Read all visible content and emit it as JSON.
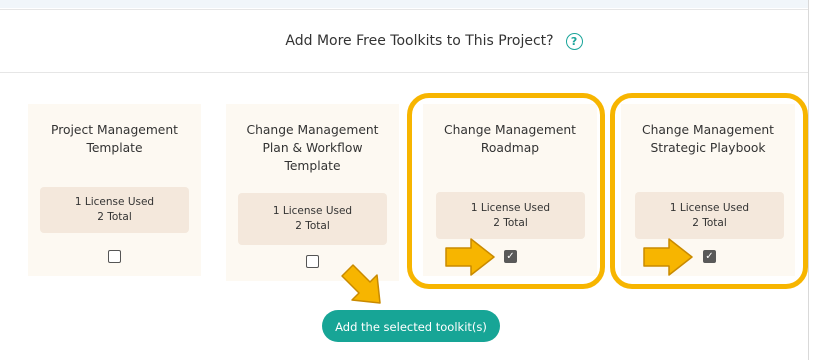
{
  "header": {
    "title": "Add More Free Toolkits to This Project?",
    "help_icon": "?"
  },
  "toolkits": [
    {
      "title_lines": [
        "Project Management",
        "Template"
      ],
      "license_used": "1 License Used",
      "license_total": "2 Total",
      "checked": false
    },
    {
      "title_lines": [
        "Change Management",
        "Plan & Workflow",
        "Template"
      ],
      "license_used": "1 License Used",
      "license_total": "2 Total",
      "checked": false
    },
    {
      "title_lines": [
        "Change Management",
        "Roadmap"
      ],
      "license_used": "1 License Used",
      "license_total": "2 Total",
      "checked": true
    },
    {
      "title_lines": [
        "Change Management",
        "Strategic Playbook"
      ],
      "license_used": "1 License Used",
      "license_total": "2 Total",
      "checked": true
    }
  ],
  "checkmark_glyph": "✓",
  "add_button_label": "Add the selected toolkit(s)",
  "colors": {
    "accent": "#17a596",
    "highlight": "#f7b500",
    "card_bg": "#fdf9f2",
    "license_bg": "#f4e8dc"
  },
  "icons": {
    "help": "help-circle-icon",
    "annotation_arrow": "yellow-arrow-icon"
  }
}
